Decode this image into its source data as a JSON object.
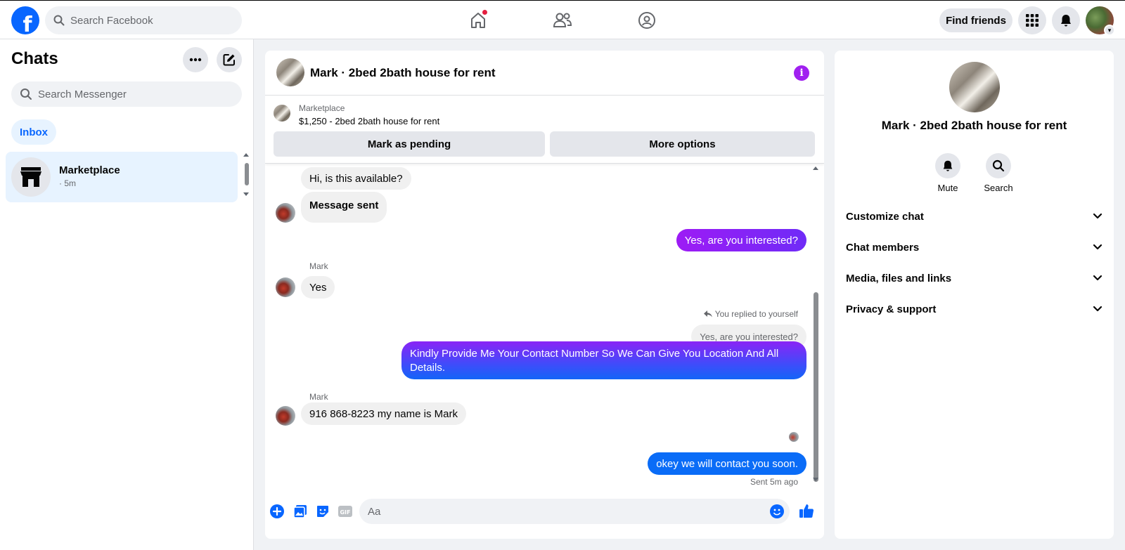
{
  "topbar": {
    "logo_letter": "f",
    "search_placeholder": "Search Facebook",
    "nav_icons": [
      "home-icon",
      "friends-icon",
      "groups-icon"
    ],
    "find_friends_label": "Find friends",
    "icons": [
      "menu-grid-icon",
      "bell-icon",
      "chevron-down-icon"
    ]
  },
  "sidebar": {
    "title": "Chats",
    "search_placeholder": "Search Messenger",
    "filter_label": "Inbox",
    "chats": [
      {
        "name": "Marketplace",
        "time": "· 5m",
        "icon": "store-icon"
      }
    ]
  },
  "conversation": {
    "title": "Mark · 2bed 2bath house for rent",
    "listing": {
      "label": "Marketplace",
      "title": "$1,250 - 2bed 2bath house for rent"
    },
    "actions": {
      "pending": "Mark as pending",
      "more": "More options"
    },
    "messages": {
      "m1": "Hi, is this available?",
      "m2": "Message sent",
      "m3": "Yes, are you interested?",
      "sender1": "Mark",
      "m4": "Yes",
      "replied_note": "You replied to yourself",
      "reply_quote": "Yes, are you interested?",
      "m5": "Kindly Provide Me Your Contact Number So We Can Give You Location And All Details.",
      "sender2": "Mark",
      "m6": "916 868-8223 my name is Mark",
      "m7": "okey we will contact you soon.",
      "status": "Sent 5m ago"
    },
    "composer_placeholder": "Aa",
    "composer_icons": [
      "plus-icon",
      "photo-icon",
      "sticker-icon",
      "gif-icon",
      "emoji-icon",
      "like-icon"
    ]
  },
  "info_panel": {
    "name": "Mark · 2bed 2bath house for rent",
    "actions": [
      {
        "label": "Mute",
        "icon": "bell-icon"
      },
      {
        "label": "Search",
        "icon": "search-icon"
      }
    ],
    "sections": [
      "Customize chat",
      "Chat members",
      "Media, files and links",
      "Privacy & support"
    ]
  },
  "colors": {
    "brand_blue": "#0866ff",
    "purple": "#9d1bf5",
    "info_purple": "#a020f0",
    "bubble_gray": "#f0f0f0"
  }
}
